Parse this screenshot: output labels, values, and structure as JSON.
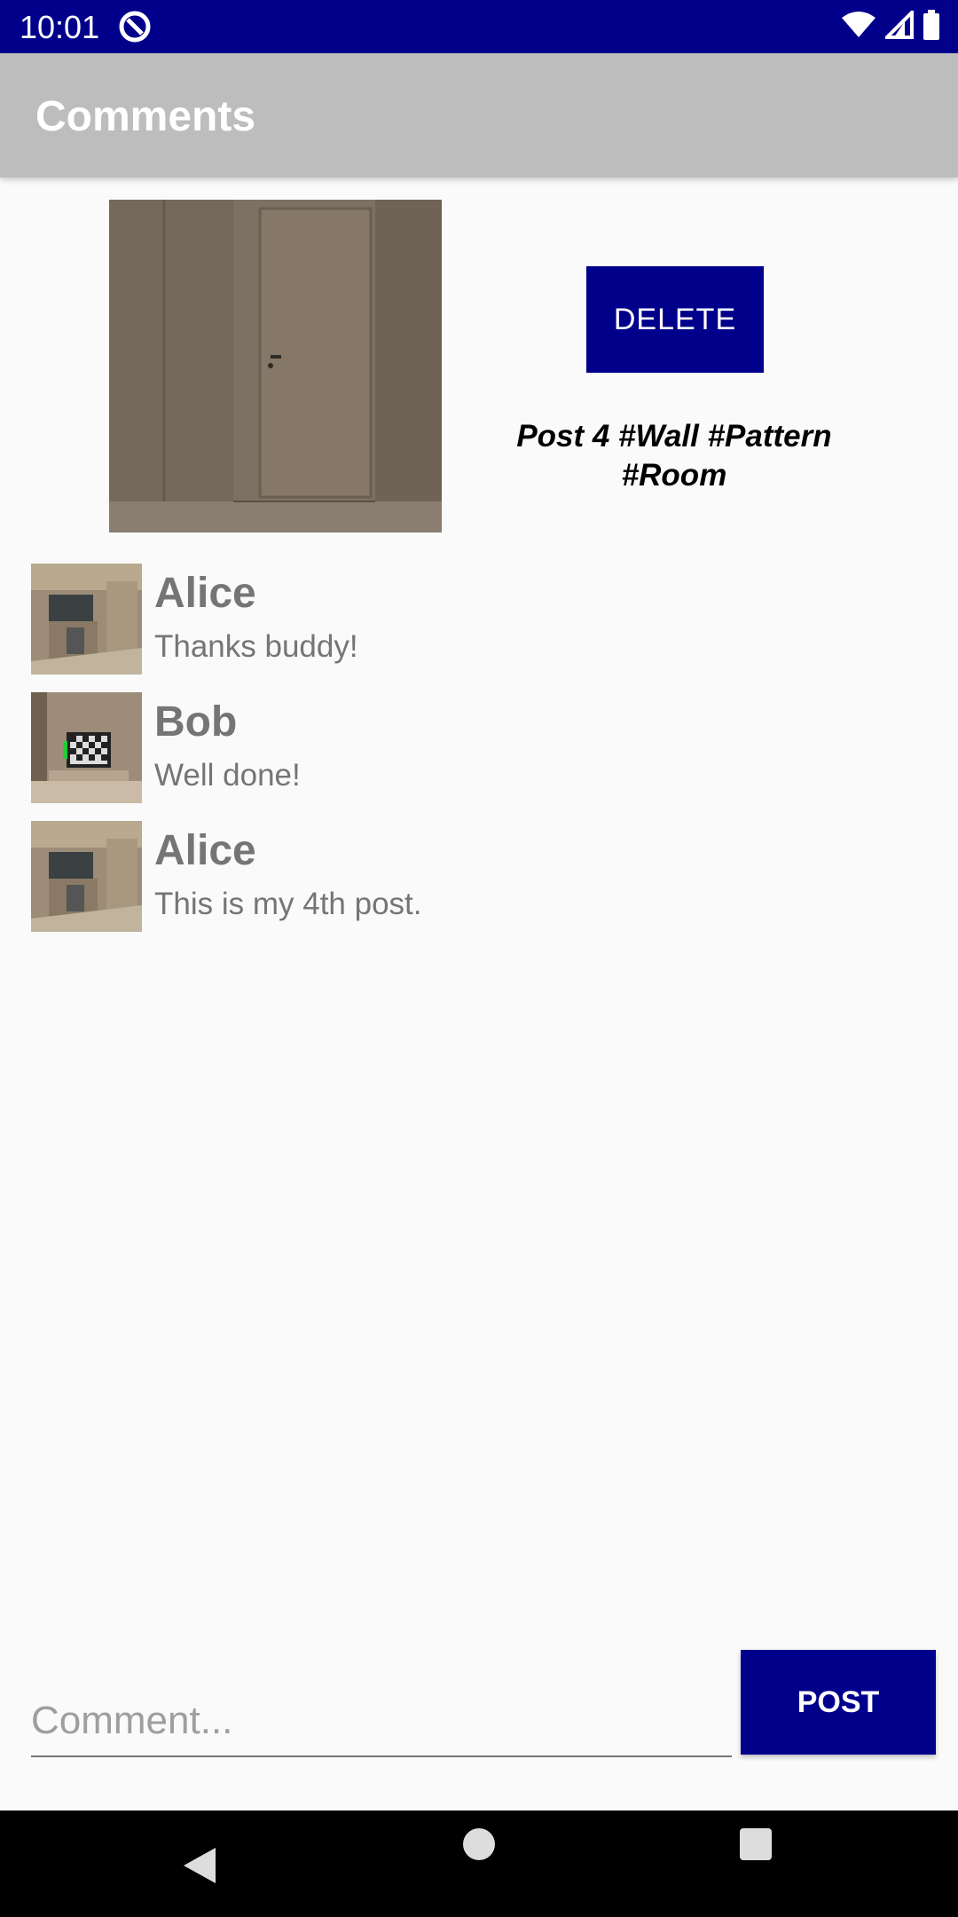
{
  "status_bar": {
    "time": "10:01",
    "icons": [
      "app-notification-icon",
      "wifi-icon",
      "signal-icon",
      "battery-icon"
    ]
  },
  "app_bar": {
    "title": "Comments"
  },
  "post": {
    "image_icon": "room-door-image",
    "delete_label": "DELETE",
    "caption": "Post 4 #Wall #Pattern #Room"
  },
  "comments": [
    {
      "name": "Alice",
      "text": "Thanks buddy!",
      "avatar": "kitchen-avatar"
    },
    {
      "name": "Bob",
      "text": "Well done!",
      "avatar": "living-room-avatar"
    },
    {
      "name": "Alice",
      "text": "This is my 4th post.",
      "avatar": "kitchen-avatar"
    }
  ],
  "composer": {
    "placeholder": "Comment...",
    "value": "",
    "post_label": "POST"
  },
  "nav_bar": {
    "icons": [
      "back-icon",
      "home-icon",
      "recents-icon"
    ]
  },
  "colors": {
    "primary": "#00008b",
    "app_bar": "#bdbdbd",
    "text_secondary": "#757575"
  }
}
